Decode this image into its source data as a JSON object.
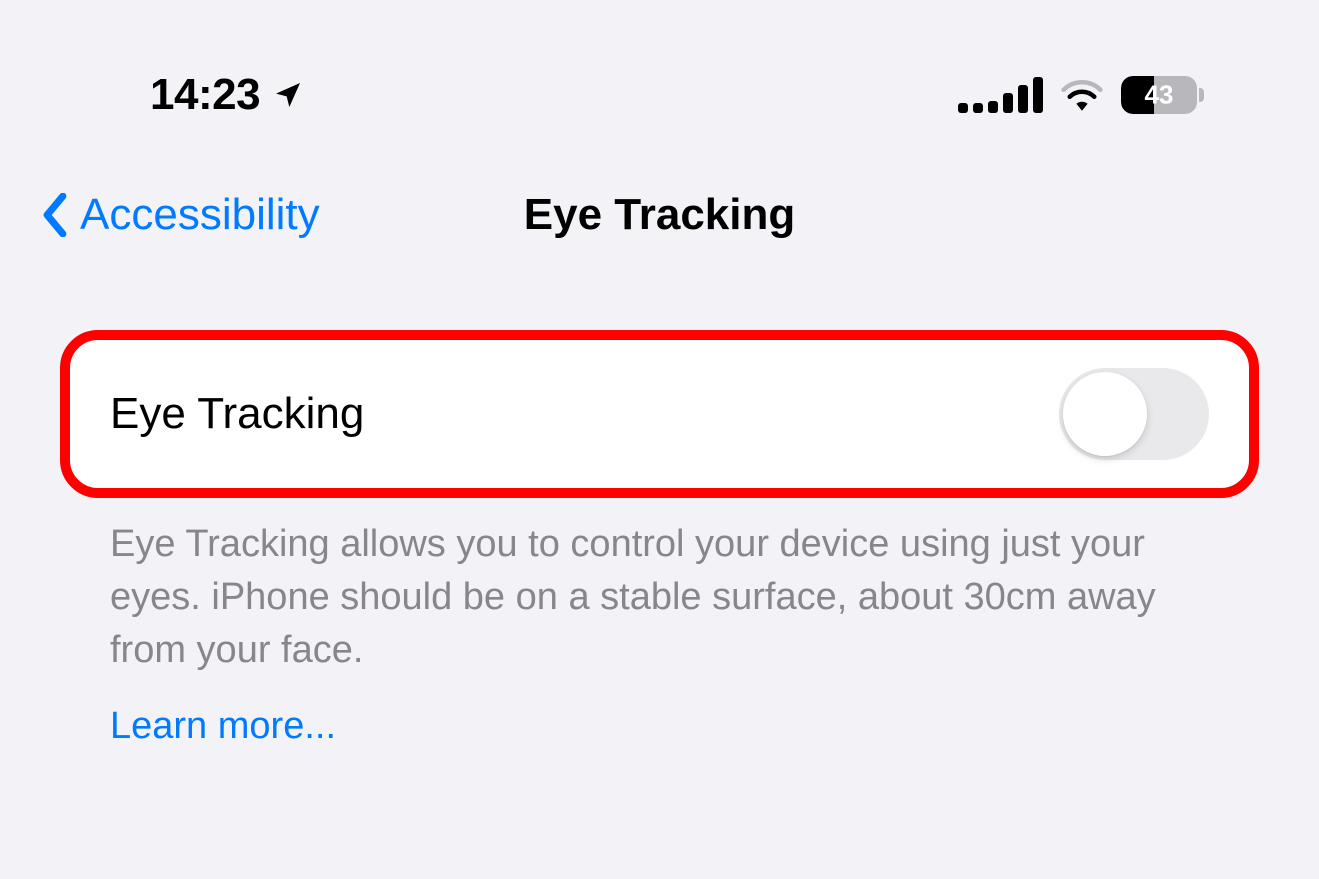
{
  "statusBar": {
    "time": "14:23",
    "batteryPercent": "43"
  },
  "nav": {
    "backLabel": "Accessibility",
    "title": "Eye Tracking"
  },
  "setting": {
    "label": "Eye Tracking",
    "enabled": false
  },
  "description": "Eye Tracking allows you to control your device using just your eyes. iPhone should be on a stable surface, about 30cm away from your face.",
  "learnMore": "Learn more..."
}
